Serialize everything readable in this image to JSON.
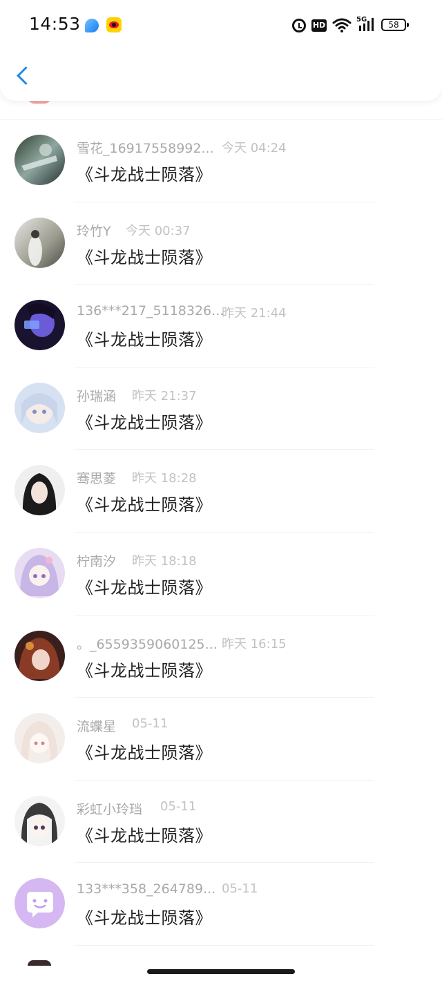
{
  "status_bar": {
    "time": "14:53",
    "hd_label": "HD",
    "signal_label": "5G",
    "battery": "58",
    "apps": [
      "qq-browser-icon",
      "weibo-icon"
    ]
  },
  "header": {
    "back_icon": "chevron-left-icon",
    "accent": "#1e88e5"
  },
  "messages": [
    {
      "name": "雪花_16917558992...",
      "time": "今天 04:24",
      "text": "《斗龙战士陨落》",
      "avatar": "avatar-1"
    },
    {
      "name": "玲竹Y",
      "time": "今天 00:37",
      "text": "《斗龙战士陨落》",
      "avatar": "avatar-2"
    },
    {
      "name": "136***217_5118326...",
      "time": "昨天 21:44",
      "text": "《斗龙战士陨落》",
      "avatar": "avatar-3"
    },
    {
      "name": "孙瑞涵",
      "time": "昨天 21:37",
      "text": "《斗龙战士陨落》",
      "avatar": "avatar-4"
    },
    {
      "name": "骞思菱",
      "time": "昨天 18:28",
      "text": "《斗龙战士陨落》",
      "avatar": "avatar-5"
    },
    {
      "name": "柠南汐",
      "time": "昨天 18:18",
      "text": "《斗龙战士陨落》",
      "avatar": "avatar-6"
    },
    {
      "name": "。_6559359060125...",
      "time": "昨天 16:15",
      "text": "《斗龙战士陨落》",
      "avatar": "avatar-7"
    },
    {
      "name": "流蝶星",
      "time": "05-11",
      "text": "《斗龙战士陨落》",
      "avatar": "avatar-8"
    },
    {
      "name": "彩虹小玲珰",
      "time": "05-11",
      "text": "《斗龙战士陨落》",
      "avatar": "avatar-9"
    },
    {
      "name": "133***358_264789...",
      "time": "05-11",
      "text": "《斗龙战士陨落》",
      "avatar": "default-chat-avatar-icon"
    }
  ]
}
